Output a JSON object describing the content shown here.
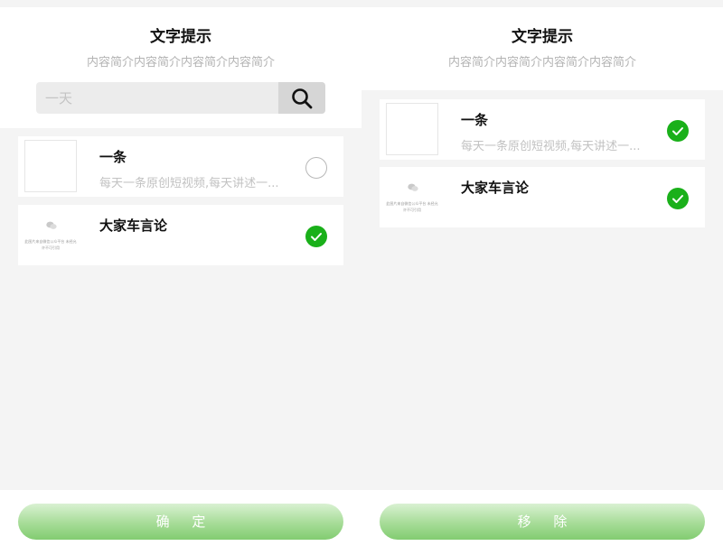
{
  "left_screen": {
    "title": "文字提示",
    "subtitle": "内容简介内容简介内容简介内容简介",
    "search": {
      "placeholder": "一天",
      "icon": "search-icon"
    },
    "items": [
      {
        "name": "一条",
        "description": "每天一条原创短视频,每天讲述一...",
        "thumbnail": "blank",
        "selected": false
      },
      {
        "name": "大家车言论",
        "description": "",
        "thumbnail": "wechat-placeholder",
        "placeholder_text": "此图片来自微信公众平台 未经允许不可引用",
        "selected": true
      }
    ],
    "footer_button": "确 定"
  },
  "right_screen": {
    "title": "文字提示",
    "subtitle": "内容简介内容简介内容简介内容简介",
    "items": [
      {
        "name": "一条",
        "description": "每天一条原创短视频,每天讲述一...",
        "thumbnail": "blank",
        "selected": true
      },
      {
        "name": "大家车言论",
        "description": "",
        "thumbnail": "wechat-placeholder",
        "placeholder_text": "此图片来自微信公众平台 未经允许不可引用",
        "selected": true
      }
    ],
    "footer_button": "移 除"
  },
  "colors": {
    "accent_green": "#1ab01a",
    "button_gradient_top": "#d9f1d2",
    "button_gradient_bottom": "#82cc71",
    "background": "#f4f4f4"
  }
}
